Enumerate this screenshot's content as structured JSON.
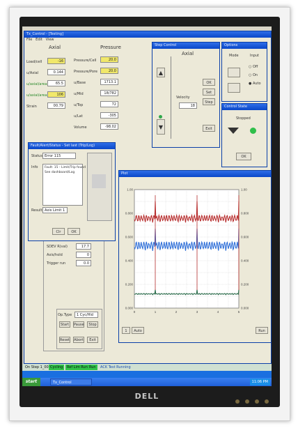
{
  "main_window": {
    "title": "Tx_Control - [Testing]",
    "menu": [
      "File",
      "Edit",
      "View"
    ]
  },
  "readouts": {
    "axial_header": "Axial",
    "pressure_header": "Pressure",
    "axial_rows": [
      {
        "label": "Load/cell",
        "value": "-16"
      },
      {
        "label": "u/Axial",
        "value": "0.144"
      },
      {
        "label": "u/axial/area",
        "value": "65.5"
      },
      {
        "label": "u/axial/area",
        "value": "106"
      },
      {
        "label": "Strain",
        "value": "00.79"
      }
    ],
    "pressure_rows": [
      {
        "label": "Pressure/Cell",
        "value": "20.0"
      },
      {
        "label": "Pressure/Pore",
        "value": "20.0"
      },
      {
        "label": "u/Base",
        "value": "1713.1"
      },
      {
        "label": "u/Mid",
        "value": "18/782"
      },
      {
        "label": "u/Top",
        "value": "72"
      },
      {
        "label": "u/Lat",
        "value": "-305"
      },
      {
        "label": "Volume",
        "value": "-98.02"
      }
    ]
  },
  "step_control": {
    "title": "Step Control",
    "mode": "Axial",
    "rate_label": "Velocity",
    "rate_value": "18",
    "buttons": [
      "OK",
      "Set",
      "Step",
      "Exit"
    ]
  },
  "options_window": {
    "title": "Options",
    "col1": "Mode",
    "col2": "Input",
    "radios": [
      "Off",
      "On",
      "Auto"
    ]
  },
  "control_state": {
    "title": "Control State",
    "label": "Stopped",
    "button": "OK"
  },
  "dialog": {
    "title": "Fault/Alert/Status - Set last (Trip/Log)",
    "status_label": "Status",
    "status_value": "Error 115",
    "info_label": "Info",
    "info_lines": [
      "Fault: 15 - Limit/Trip found",
      "See dashboard/Log"
    ],
    "results_label": "Results",
    "results_value": "Axis Limit 1",
    "buttons": [
      "Clr",
      "OK"
    ]
  },
  "plot_window": {
    "title": "Plot",
    "bottom_buttons": [
      "1",
      "Auto"
    ],
    "right_button": "Run"
  },
  "lower_panel": {
    "rows": [
      {
        "label": "SDEV R(val)",
        "value": "17.7"
      },
      {
        "label": "Axis/hold",
        "value": "0"
      },
      {
        "label": "Trigger run",
        "value": "0.0"
      }
    ],
    "select_label": "Op.Type",
    "select_value": "1 Cyc/Hld",
    "buttons": [
      "Start",
      "Pause",
      "Stop",
      "Reset",
      "Abort",
      "Exit"
    ]
  },
  "chart_data": {
    "type": "line",
    "series": [
      {
        "color": "#b83030"
      },
      {
        "color": "#2f6fd8"
      },
      {
        "color": "#2a6b4a"
      }
    ],
    "y_ticks": [
      "1.00",
      "0.800",
      "0.600",
      "0.400",
      "0.200",
      "0.000"
    ],
    "x_ticks": [
      "0",
      "1",
      "2",
      "3",
      "4",
      "5"
    ],
    "spikes_at": [
      1,
      3,
      5
    ],
    "grid": true
  },
  "statusbar": {
    "items": [
      "On Step 1_001",
      "Cycling",
      "Ref Lim Run",
      "Run",
      "ACK Test Running"
    ]
  },
  "taskbar": {
    "start": "start",
    "tasks": [
      "Tx_Control"
    ],
    "clock": "11:06 PM"
  },
  "monitor": {
    "brand": "DELL"
  }
}
